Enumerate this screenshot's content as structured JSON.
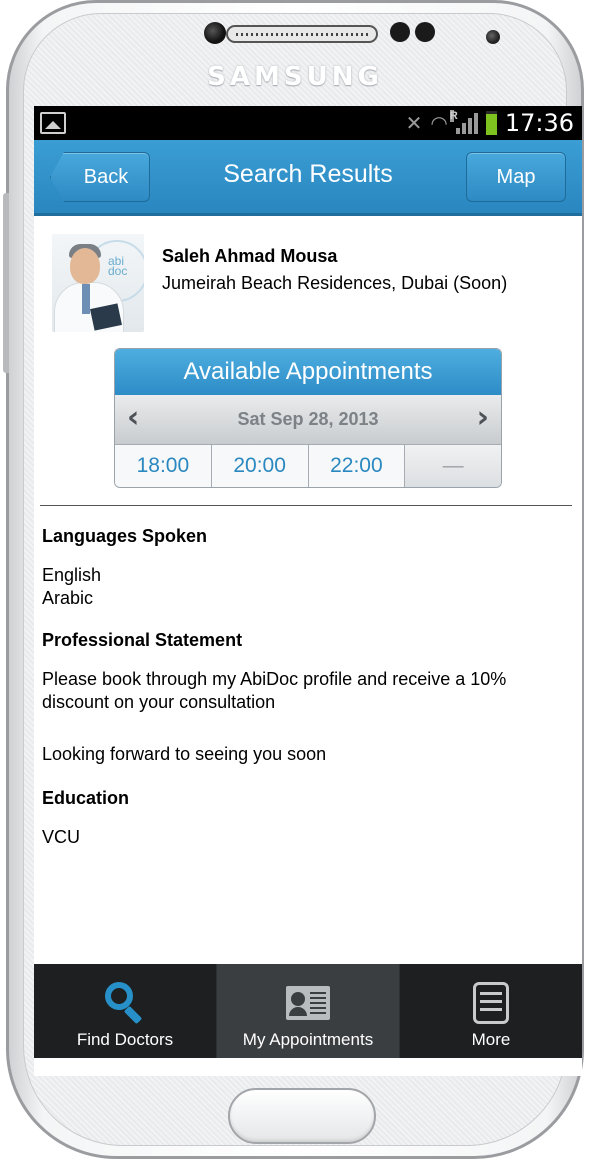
{
  "device": {
    "brand": "SAMSUNG"
  },
  "status_bar": {
    "time": "17:36",
    "network_badge": "R"
  },
  "header": {
    "back_label": "Back",
    "title": "Search Results",
    "map_label": "Map"
  },
  "doctor": {
    "name": "Saleh Ahmad Mousa",
    "address": "Jumeirah Beach Residences, Dubai (Soon)",
    "logo_text_1": "abi",
    "logo_text_2": "doc"
  },
  "appointments": {
    "title": "Available Appointments",
    "date": "Sat Sep 28, 2013",
    "slots": [
      "18:00",
      "20:00",
      "22:00",
      "—"
    ]
  },
  "languages": {
    "heading": "Languages Spoken",
    "items": [
      "English",
      "Arabic"
    ]
  },
  "statement": {
    "heading": "Professional Statement",
    "para1": "Please book through my AbiDoc profile and receive a 10% discount on your consultation",
    "para2": "Looking forward to seeing you soon"
  },
  "education": {
    "heading": "Education",
    "value": "VCU"
  },
  "tabs": [
    {
      "label": "Find Doctors",
      "icon": "search-icon"
    },
    {
      "label": "My Appointments",
      "icon": "id-card-icon"
    },
    {
      "label": "More",
      "icon": "menu-icon"
    }
  ],
  "colors": {
    "accent": "#2a86bf",
    "slot_text": "#2a88c0",
    "tab_bar": "#1d1f20"
  }
}
